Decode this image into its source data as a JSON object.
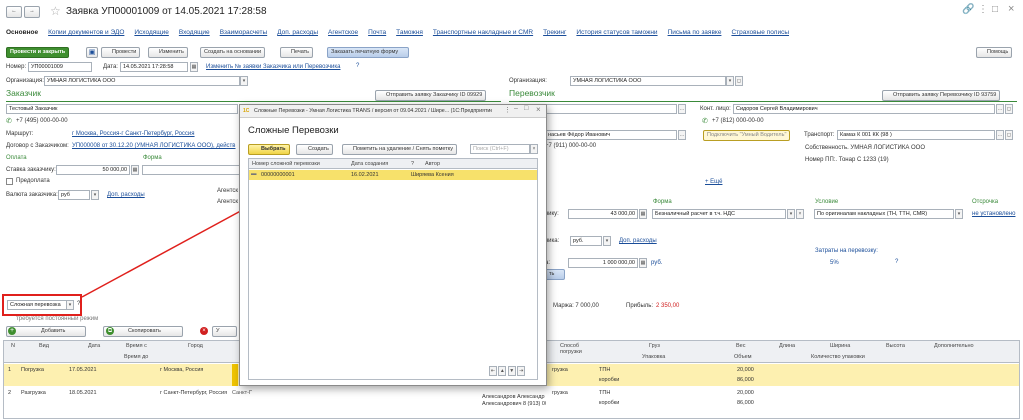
{
  "window": {
    "title": "Заявка УП00001009 от 14.05.2021 17:28:58"
  },
  "tabs": [
    "Основное",
    "Копии документов и ЭДО",
    "Исходящие",
    "Входящие",
    "Взаиморасчеты",
    "Доп. расходы",
    "Агентское",
    "Почта",
    "Таможня",
    "Транспортные накладные и CMR",
    "Трекинг",
    "История статусов таможни",
    "Письма по заявке",
    "Страховые полисы"
  ],
  "toolbar": {
    "post_close": "Провести и закрыть",
    "post": "Провести",
    "change": "Изменить",
    "create_based": "Создать на основании",
    "print": "Печать",
    "order_form": "Заказать печатную форму",
    "help": "Помощь"
  },
  "header": {
    "number_label": "Номер:",
    "number": "УП00001009",
    "date_label": "Дата:",
    "date": "14.05.2021 17:28:58",
    "change_link": "Изменить № заявки Заказчика или Перевозчика",
    "question": "?"
  },
  "customer": {
    "org_label": "Организация:",
    "org": "УМНАЯ ЛОГИСТИКА ООО",
    "section": "Заказчик",
    "send_btn": "Отправить заявку Заказчику ID 09929",
    "name": "Тестовый Заказчик",
    "phone": "+7 (495) 000-00-00",
    "route_label": "Маршрут:",
    "route": "г Москва, Россия-г Санкт-Петербург, Россия",
    "contract_label": "Договор с Заказчиком:",
    "contract": "УП000008 от 30.12.20 (УМНАЯ ЛОГИСТИКА ООО), действ",
    "pay_label": "Оплата",
    "form_label": "Форма",
    "rate_label": "Ставка заказчику:",
    "rate": "50 000,00",
    "prepay": "Предоплата",
    "currency_label": "Валюта заказчика:",
    "currency": "руб",
    "extra_link": "Доп. расходы",
    "agent1": "Агентск",
    "agent2": "Агентск"
  },
  "carrier": {
    "org_label": "Организация:",
    "org": "УМНАЯ ЛОГИСТИКА ООО",
    "section": "Перевозчик",
    "send_btn": "Отправить заявку Перевозчику ID 93759",
    "contact_label": "Конт. лицо:",
    "contact": "Сидоров Сергей Владимирович",
    "phone": "+7 (812) 000-00-00",
    "driver": "насьев Фёдор Иванович",
    "driver_phone": "+7 (911) 000-00-00",
    "smart_btn": "Подключить \"Умный Водитель\"",
    "transport_label": "Транспорт:",
    "transport": "Камаз К 001 КК (98 )",
    "own": "Собственность. УМНАЯ ЛОГИСТИКА ООО",
    "trailer": "Номер ПП:. Тонар С 1233 (19)",
    "more": "+ Ещё",
    "form_label": "Форма",
    "condition_label": "Условие",
    "delay_label": "Отсрочка",
    "rate_frag": "чику:",
    "rate": "43 000,00",
    "form": "Безналичный расчет в т.ч. НДС",
    "condition": "По оригиналам накладных (ТН, ТТН, CMR)",
    "delay": "не установлено",
    "cur_frag": "чика:",
    "currency": "руб.",
    "extra_link": "Доп. расходы",
    "costs_label": "Затраты на перевозку:",
    "costs": "5%",
    "cost_frag": "а:",
    "cost": "1 000 000,00",
    "cost_cur": "руб.",
    "margin": "Маржа:  7 000,00",
    "profit_label": "Прибыль:",
    "profit": "2 350,00"
  },
  "complex": {
    "combo": "Сложная перевозка",
    "question": "?",
    "mode": "требуется постоянный режим",
    "add": "Добавить",
    "copy": "Скопировать"
  },
  "grid": {
    "cols": [
      "N",
      "Вид",
      "Дата",
      "Время с",
      "Город",
      "Способ погрузки",
      "Груз",
      "Вес",
      "Длина",
      "Ширина",
      "Высота",
      "Дополнительно"
    ],
    "sub": [
      "Время до",
      "Упаковка",
      "Объем",
      "Количество упаковки"
    ],
    "rows": [
      {
        "n": "1",
        "kind": "Погрузка",
        "date": "17.05.2021",
        "city": "г Москва, Россия",
        "method": "грузка",
        "cargo": "ТПН",
        "pack": "коробки",
        "w": "20,000",
        "v": "86,000"
      },
      {
        "n": "2",
        "kind": "Разгрузка",
        "date": "18.05.2021",
        "city": "г Санкт-Петербург, Россия",
        "addr": "Санкт-Петербург г, Первомайская ул, дом № 1, оф 201",
        "person": "Александров Александр Александрович",
        "person_tel": "Александрович 8 (913) 00 00 000",
        "method": "грузка",
        "cargo": "ТПН",
        "pack": "коробки",
        "w": "20,000",
        "v": "86,000"
      }
    ]
  },
  "modal": {
    "title": "Сложные Перевозки - Умная Логистика TRANS / версия от 09.04.2021 / Шире... (1С:Предприятие)",
    "heading": "Сложные Перевозки",
    "select": "Выбрать",
    "create": "Создать",
    "mark": "Пометить на удаление / Снять пометку",
    "search_ph": "Поиск (Ctrl+F)",
    "cols": [
      "Номер сложной перевозки",
      "Дата создания",
      "Автор"
    ],
    "question": "?",
    "row": {
      "num": "00000000001",
      "date": "16.02.2021",
      "author": "Ширяева Ксения"
    }
  },
  "colors": {
    "accent": "#3f8f2f",
    "highlight": "#f7e16b",
    "arrow": "#e0201c"
  }
}
